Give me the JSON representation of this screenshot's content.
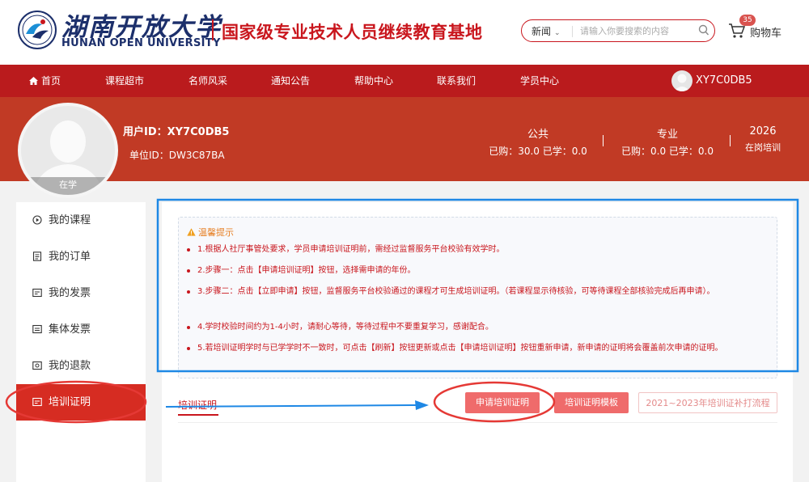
{
  "header": {
    "logo_cn": "湖南开放大学",
    "logo_en": "HUNAN OPEN UNIVERSITY",
    "slogan": "国家级专业技术人员继续教育基地",
    "search": {
      "category": "新闻",
      "placeholder": "请输入你要搜索的内容"
    },
    "cart": {
      "label": "购物车",
      "count": "35"
    }
  },
  "nav": {
    "items": [
      {
        "label": "首页"
      },
      {
        "label": "课程超市"
      },
      {
        "label": "名师风采"
      },
      {
        "label": "通知公告"
      },
      {
        "label": "帮助中心"
      },
      {
        "label": "联系我们"
      },
      {
        "label": "学员中心"
      }
    ],
    "username": "XY7C0DB5"
  },
  "profile": {
    "status": "在学",
    "user_id": "用户ID：XY7C0DB5",
    "unit_id": "单位ID：DW3C87BA",
    "stats": [
      {
        "title": "公共",
        "value": "已购：30.0 已学：0.0"
      },
      {
        "title": "专业",
        "value": "已购：0.0 已学：0.0"
      },
      {
        "title": "2026",
        "value": "在岗培训"
      }
    ]
  },
  "sidebar": {
    "items": [
      {
        "label": "我的课程",
        "icon": "play-circle-icon"
      },
      {
        "label": "我的订单",
        "icon": "document-icon"
      },
      {
        "label": "我的发票",
        "icon": "invoice-icon"
      },
      {
        "label": "集体发票",
        "icon": "group-invoice-icon"
      },
      {
        "label": "我的退款",
        "icon": "refund-icon"
      },
      {
        "label": "培训证明",
        "icon": "certificate-icon",
        "active": true
      }
    ]
  },
  "notice": {
    "title": "温馨提示",
    "lines": [
      "1.根据人社厅事管处要求，学员申请培训证明前，需经过监督服务平台校验有效学时。",
      "2.步骤一：点击【申请培训证明】按钮，选择需申请的年份。",
      "3.步骤二：点击【立即申请】按钮，监督服务平台校验通过的课程才可生成培训证明。（若课程显示待核验，可等待课程全部核验完成后再申请）。",
      "4.学时校验时间约为1-4小时，请耐心等待，等待过程中不要重复学习，感谢配合。",
      "5.若培训证明学时与已学学时不一致时，可点击【刷新】按钮更新或点击【申请培训证明】按钮重新申请，新申请的证明将会覆盖前次申请的证明。"
    ]
  },
  "tabs": {
    "active": "培训证明"
  },
  "actions": {
    "apply": "申请培训证明",
    "template": "培训证明模板",
    "reprint": "2021~2023年培训证补打流程"
  },
  "colors": {
    "brand_red": "#ba1b1d",
    "banner_red": "#c13a25",
    "sidebar_active": "#d62c22",
    "button_red": "#ef6b6b",
    "annotation_blue": "#1e88e5",
    "annotation_red": "#e53935"
  }
}
